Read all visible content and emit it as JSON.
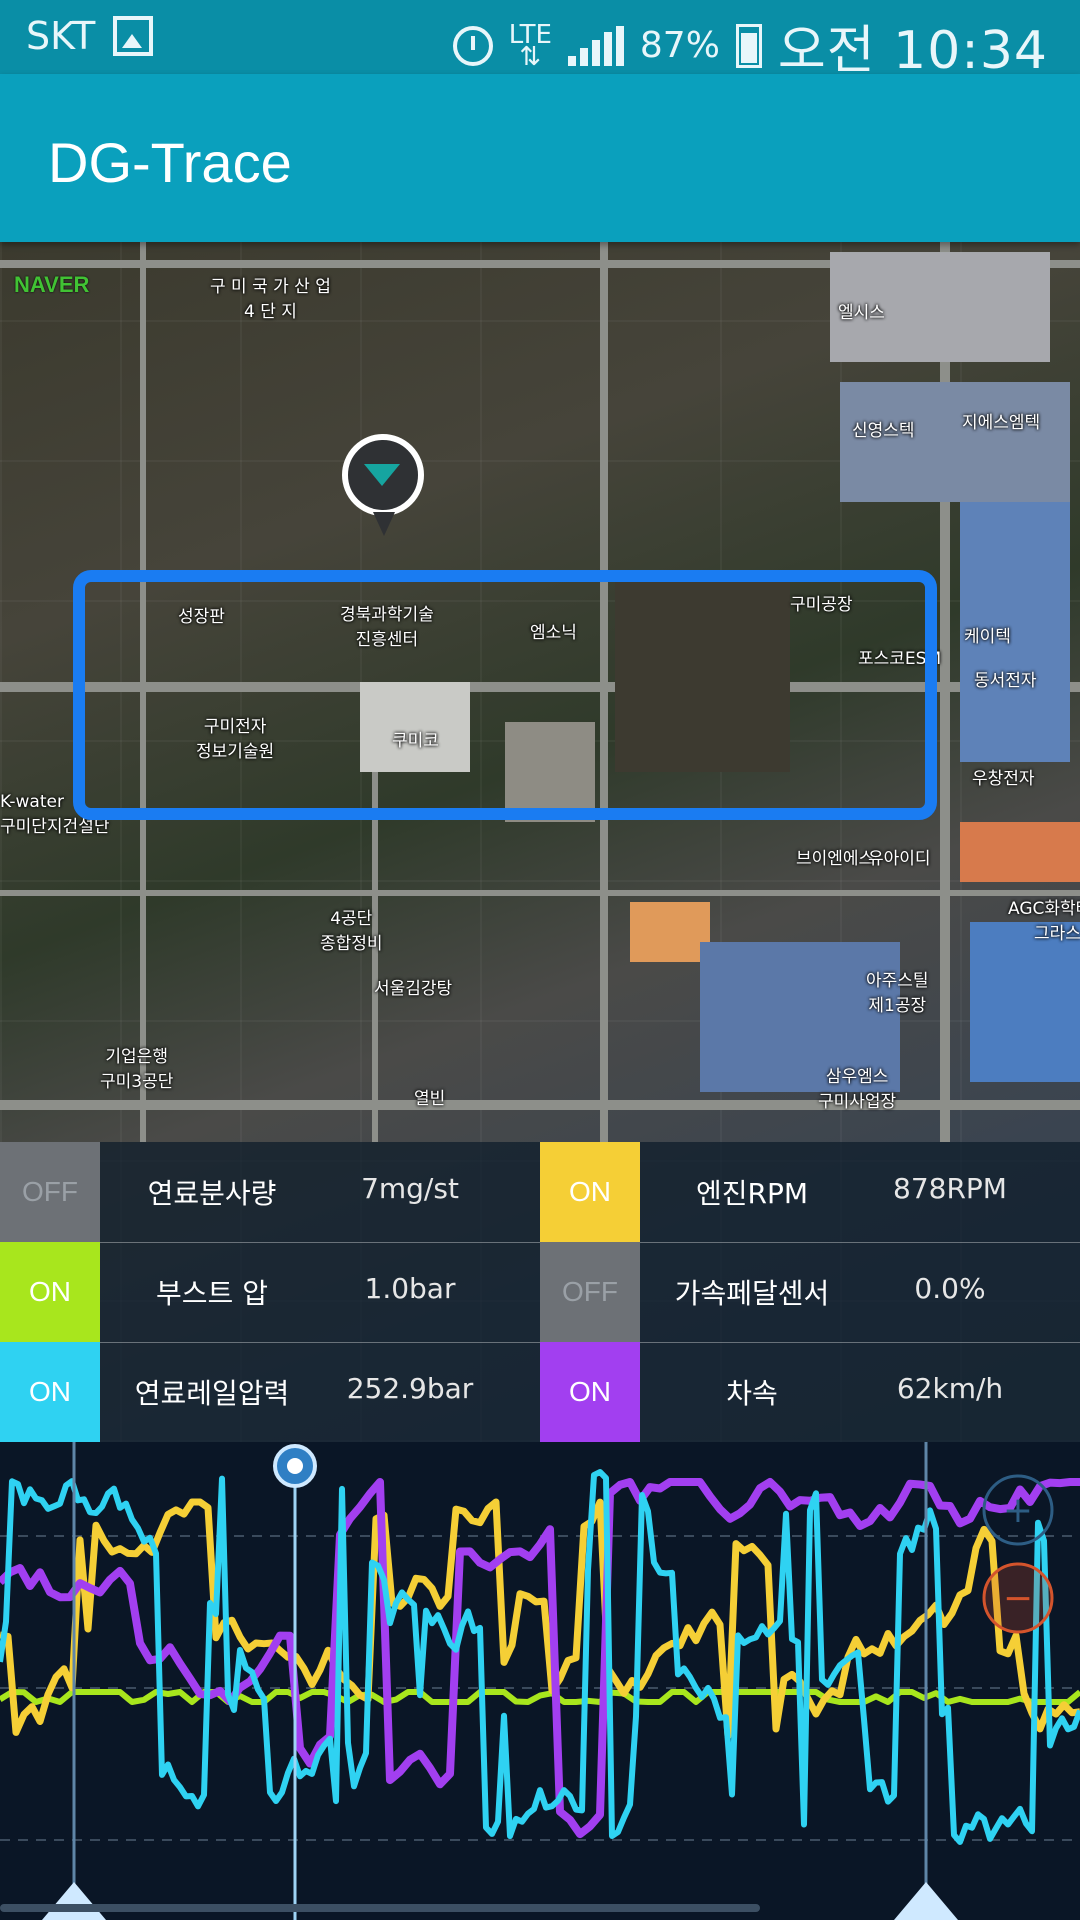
{
  "status_bar": {
    "carrier": "SKT",
    "network": "LTE",
    "battery": "87%",
    "time": "오전 10:34",
    "icons": [
      "gallery-icon",
      "alarm-icon",
      "signal-icon",
      "battery-icon"
    ]
  },
  "app_bar": {
    "title": "DG-Trace"
  },
  "map": {
    "provider_logo": "NAVER",
    "labels": [
      "구 미 국 가 산 업\n4 단 지",
      "성장판",
      "경북과학기술\n진흥센터",
      "엠소닉",
      "구미전자\n정보기술원",
      "쿠미코",
      "구미공장",
      "포스코ESM",
      "케이텍",
      "동서전자",
      "우창전자",
      "엘시스",
      "신영스텍",
      "지에스엠텍",
      "K-water\n구미단지건설단",
      "4공단\n종합정비",
      "서울김강탕",
      "아주스틸\n제1공장",
      "AGC화학테크\n그라스",
      "브이엔에스",
      "유아이디",
      "삼우엠스\n구미사업장",
      "기업은행\n구미3공단",
      "열빈"
    ]
  },
  "sensors": [
    {
      "state": "OFF",
      "name": "연료분사량",
      "value": "7mg/st",
      "color": "#6d7176"
    },
    {
      "state": "ON",
      "name": "엔진RPM",
      "value": "878RPM",
      "color": "#f5cf36"
    },
    {
      "state": "ON",
      "name": "부스트 압",
      "value": "1.0bar",
      "color": "#a8e61d"
    },
    {
      "state": "OFF",
      "name": "가속페달센서",
      "value": "0.0%",
      "color": "#6d7176"
    },
    {
      "state": "ON",
      "name": "연료레일압력",
      "value": "252.9bar",
      "color": "#2fd2f2"
    },
    {
      "state": "ON",
      "name": "차속",
      "value": "62km/h",
      "color": "#a23ff0"
    }
  ],
  "graph_controls": {
    "zoom_in": "+",
    "zoom_out": "−"
  },
  "graph_series_colors": {
    "rpm": "#f5cf36",
    "boost": "#a8e61d",
    "rail": "#2fd2f2",
    "speed": "#a23ff0"
  }
}
